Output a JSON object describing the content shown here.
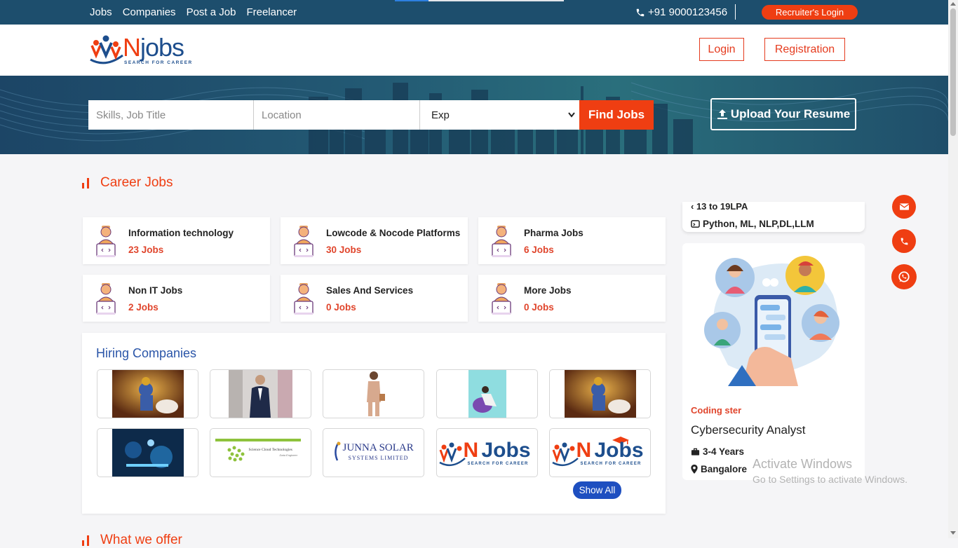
{
  "topbar": {
    "nav": [
      "Jobs",
      "Companies",
      "Post a Job",
      "Freelancer"
    ],
    "phone": "+91 9000123456",
    "recruiter_login": "Recruiter's Login"
  },
  "header": {
    "logo_word_n": "N",
    "logo_word_rest": "jobs",
    "logo_tagline": "SEARCH FOR CAREER",
    "login": "Login",
    "registration": "Registration"
  },
  "search": {
    "skills_placeholder": "Skills, Job Title",
    "location_placeholder": "Location",
    "exp_selected": "Exp",
    "find_jobs": "Find Jobs",
    "upload_resume": "Upload Your Resume"
  },
  "career": {
    "title": "Career Jobs",
    "categories": [
      {
        "name": "Information technology",
        "count": "23 Jobs"
      },
      {
        "name": "Lowcode & Nocode Platforms",
        "count": "30 Jobs"
      },
      {
        "name": "Pharma Jobs",
        "count": "6 Jobs"
      },
      {
        "name": "Non IT Jobs",
        "count": "2 Jobs"
      },
      {
        "name": "Sales And Services",
        "count": "0 Jobs"
      },
      {
        "name": "More Jobs",
        "count": "0 Jobs"
      }
    ]
  },
  "hiring": {
    "title": "Hiring Companies",
    "logo_texts": {
      "science_cloud": "Science Cloud Technologies",
      "science_cloud_sub": "Data Engineer",
      "junna_1": "JUNNA SOLAR",
      "junna_2": "SYSTEMS LIMITED",
      "njobs_n": "N",
      "njobs_word": "Jobs",
      "njobs_tag": "SEARCH FOR CAREER"
    },
    "show_all": "Show All"
  },
  "sidebar": {
    "prev_salary": "13 to 19LPA",
    "prev_skills": "Python, ML, NLP,DL,LLM",
    "job": {
      "company": "Coding ster",
      "title": "Cybersecurity Analyst",
      "experience": "3-4 Years",
      "location": "Bangalore"
    }
  },
  "bottom_section_title": "What we offer",
  "os_overlay": {
    "line1": "Activate Windows",
    "line2": "Go to Settings to activate Windows."
  },
  "colors": {
    "topbar": "#1d4e6d",
    "accent": "#ef3e12",
    "blue_link": "#2a55a8",
    "show_all": "#1e4fc0"
  }
}
